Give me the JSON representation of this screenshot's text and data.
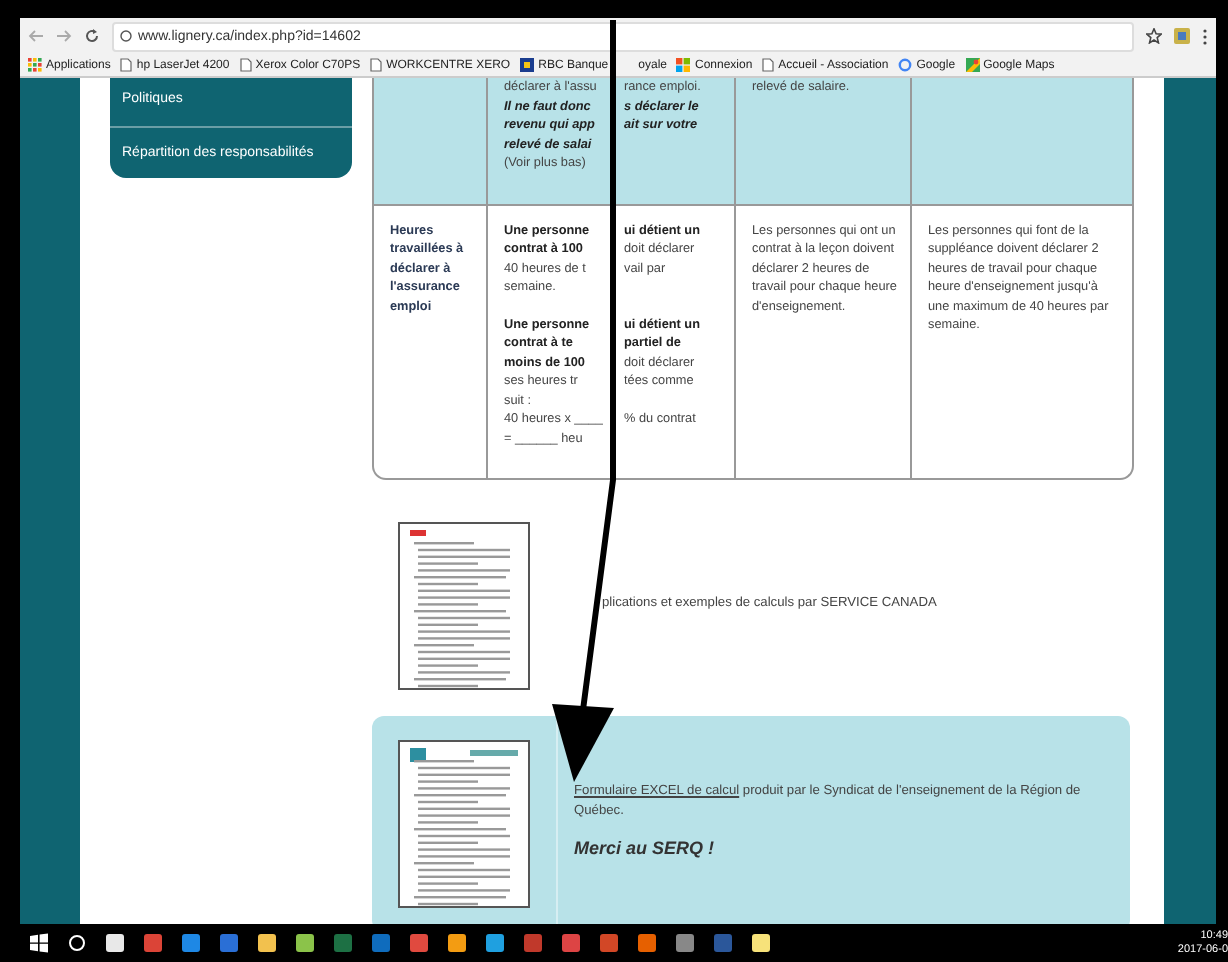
{
  "browser": {
    "url": "www.lignery.ca/index.php?id=14602",
    "bookmarks": [
      {
        "label": "Applications",
        "kind": "apps"
      },
      {
        "label": "hp LaserJet 4200",
        "kind": "page"
      },
      {
        "label": "Xerox Color C70PS",
        "kind": "page"
      },
      {
        "label": "WORKCENTRE XERO",
        "kind": "page"
      },
      {
        "label": "RBC Banque",
        "rest": "oyale",
        "kind": "bank"
      },
      {
        "label": "Connexion",
        "kind": "windows"
      },
      {
        "label": "Accueil - Association",
        "kind": "page"
      },
      {
        "label": "Google",
        "kind": "google"
      },
      {
        "label": "Google Maps",
        "kind": "maps"
      }
    ]
  },
  "sidebar": {
    "items": [
      {
        "label": "Politiques"
      },
      {
        "label": "Répartition des responsabilités"
      }
    ]
  },
  "table": {
    "rows": [
      {
        "highlight": true,
        "cells": [
          [],
          [
            {
              "kind": "lines",
              "lines": [
                {
                  "kind": "plain",
                  "left": "déclarer à l'assu",
                  "right": "rance emploi."
                },
                {
                  "kind": "emphasis",
                  "left": "Il ne faut donc",
                  "right": "s déclarer le"
                },
                {
                  "kind": "emphasis",
                  "left": "revenu qui app",
                  "right": "ait sur votre"
                },
                {
                  "kind": "emphasis",
                  "left": "relevé de salai"
                },
                {
                  "kind": "plain",
                  "left": "(Voir plus bas)"
                }
              ]
            }
          ],
          [
            {
              "kind": "text",
              "text": "relevé de salaire."
            }
          ],
          []
        ]
      },
      {
        "highlight": false,
        "cells": [
          [
            {
              "kind": "header",
              "text": "Heures travaillées à déclarer à l'assurance emploi"
            }
          ],
          [
            {
              "kind": "lines",
              "lines": [
                {
                  "kind": "bold",
                  "left": "Une personne",
                  "right": "ui détient un"
                },
                {
                  "kind": "bold-left",
                  "left": "contrat à 100",
                  "right": "doit déclarer"
                },
                {
                  "kind": "plain",
                  "left": "40 heures de t",
                  "right": "vail par"
                },
                {
                  "kind": "plain",
                  "left": "semaine."
                }
              ]
            },
            {
              "kind": "lines",
              "lines": [
                {
                  "kind": "bold",
                  "left": "Une personne",
                  "right": "ui détient un"
                },
                {
                  "kind": "bold",
                  "left": "contrat à te",
                  "right": "partiel de"
                },
                {
                  "kind": "bold-left",
                  "left": "moins de 100",
                  "right": "doit déclarer"
                },
                {
                  "kind": "plain",
                  "left": "ses heures tr",
                  "right": "tées comme"
                },
                {
                  "kind": "plain",
                  "left": "suit :"
                },
                {
                  "kind": "plain",
                  "left": "40 heures x ____",
                  "right": "% du contrat"
                },
                {
                  "kind": "plain",
                  "left": "= ______ heu"
                }
              ]
            }
          ],
          [
            {
              "kind": "text",
              "text": "Les personnes qui ont un contrat à la leçon doivent déclarer 2 heures de travail pour chaque heure d'enseignement."
            }
          ],
          [
            {
              "kind": "text",
              "text": "Les personnes qui font de la suppléance doivent déclarer 2 heures de travail pour chaque heure d'enseignement jusqu'à une maximum de 40 heures par semaine."
            }
          ]
        ]
      }
    ]
  },
  "resources": [
    {
      "highlight": false,
      "link": "plications et exemples de calculs par SERVICE CANADA"
    },
    {
      "highlight": true,
      "link": "Formulaire EXCEL de calcul",
      "text": " produit par le Syndicat de l'enseignement de la Région de Québec.",
      "note": "Merci au SERQ !"
    }
  ],
  "taskbar": {
    "time": "10:49",
    "date": "2017-06-0"
  }
}
